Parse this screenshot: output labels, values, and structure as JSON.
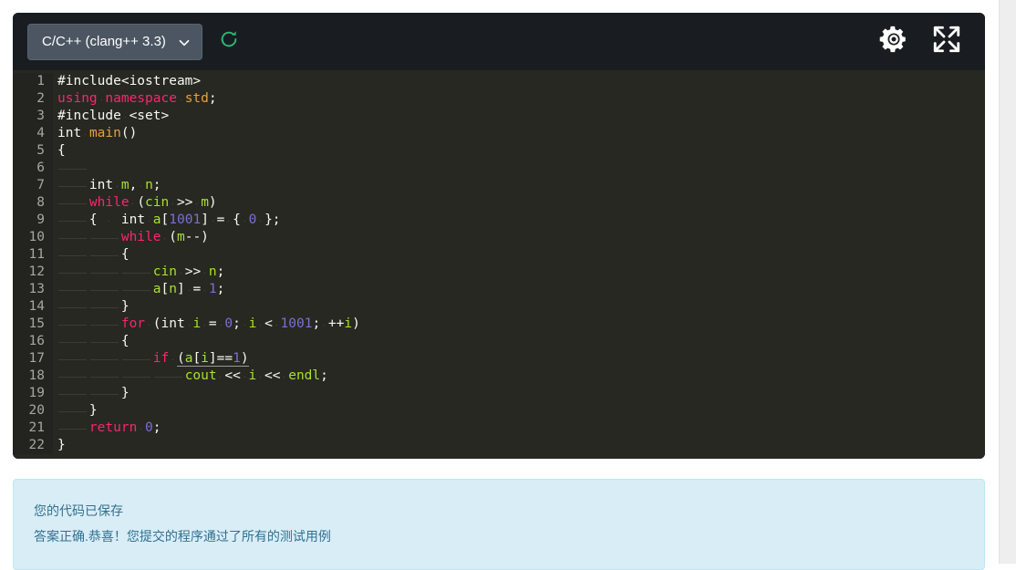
{
  "editor": {
    "toolbar": {
      "language_label": "C/C++ (clang++ 3.3)",
      "chevron_icon": "chevron-down-icon",
      "refresh_icon": "refresh-icon",
      "refresh_color": "#2bb673",
      "settings_icon": "gear-icon",
      "fullscreen_icon": "expand-arrows-icon",
      "icon_color": "#ffffff",
      "background_color": "#191d21",
      "select_background_color": "#4b5662"
    },
    "theme": {
      "code_background": "#272822",
      "gutter_background": "#232420",
      "default_text": "#f8f8f2",
      "keyword": "#f92672",
      "number": "#7a6fd6",
      "identifier": "#a6e22e",
      "function": "#e6a23c",
      "line_number": "#a7a7a0"
    },
    "code_lines": [
      {
        "num": "1",
        "text": "#include<iostream>"
      },
      {
        "num": "2",
        "text": "using namespace std;"
      },
      {
        "num": "3",
        "text": "#include <set>"
      },
      {
        "num": "4",
        "text": "int main()"
      },
      {
        "num": "5",
        "text": "{"
      },
      {
        "num": "6",
        "text": "    "
      },
      {
        "num": "7",
        "text": "    int m, n;"
      },
      {
        "num": "8",
        "text": "    while (cin >> m)"
      },
      {
        "num": "9",
        "text": "    {   int a[1001] = { 0 };"
      },
      {
        "num": "10",
        "text": "        while (m--)"
      },
      {
        "num": "11",
        "text": "        {"
      },
      {
        "num": "12",
        "text": "            cin >> n;"
      },
      {
        "num": "13",
        "text": "            a[n] = 1;"
      },
      {
        "num": "14",
        "text": "        }"
      },
      {
        "num": "15",
        "text": "        for (int i = 0; i < 1001; ++i)"
      },
      {
        "num": "16",
        "text": "        {"
      },
      {
        "num": "17",
        "text": "            if (a[i]==1)"
      },
      {
        "num": "18",
        "text": "                cout << i << endl;"
      },
      {
        "num": "19",
        "text": "        }"
      },
      {
        "num": "20",
        "text": "    }"
      },
      {
        "num": "21",
        "text": "    return 0;"
      },
      {
        "num": "22",
        "text": "}"
      }
    ]
  },
  "alert": {
    "line1": "您的代码已保存",
    "line2": "答案正确.恭喜！您提交的程序通过了所有的测试用例",
    "background_color": "#d9edf7",
    "border_color": "#bce8f1",
    "text_color": "#31708f"
  }
}
